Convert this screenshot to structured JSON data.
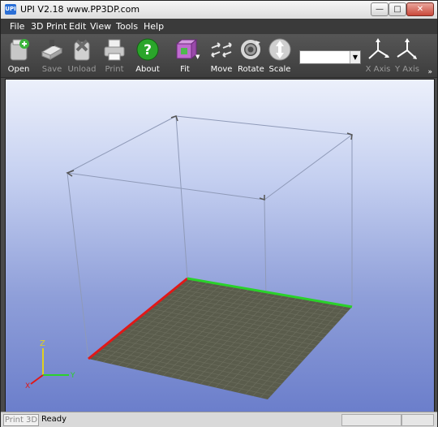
{
  "window": {
    "title": "UPI  V2.18 www.PP3DP.com",
    "app_icon_text": "UPI"
  },
  "window_controls": {
    "minimize": "—",
    "maximize": "□",
    "close": "✕"
  },
  "menu": {
    "items": [
      "File",
      "3D Print",
      "Edit",
      "View",
      "Tools",
      "Help"
    ]
  },
  "toolbar": {
    "open": "Open",
    "save": "Save",
    "unload": "Unload",
    "print": "Print",
    "about": "About",
    "fit": "Fit",
    "move": "Move",
    "rotate": "Rotate",
    "scale": "Scale",
    "x_axis": "X Axis",
    "y_axis": "Y Axis",
    "combo_value": "",
    "combo_arrow": "▼",
    "more": "»"
  },
  "axis_indicator": {
    "z": "Z",
    "y": "Y",
    "x": "X"
  },
  "status": {
    "tab": "Print 3D",
    "text": "Ready"
  },
  "colors": {
    "x_axis": "#e01818",
    "y_axis": "#2ad12a",
    "platform": "#5a5c4c",
    "grid": "#6e7060",
    "frame": "#8f9ab8"
  }
}
